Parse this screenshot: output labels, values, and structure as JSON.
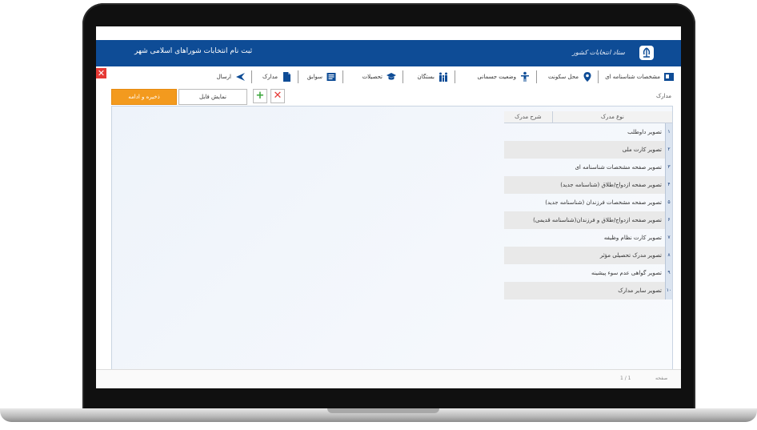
{
  "header": {
    "title": "ثبت نام انتخابات شوراهای اسلامی شهر",
    "brand": "ستاد انتخابات کشور",
    "brand_color": "#0e4c96"
  },
  "tabs": [
    {
      "label": "مشخصات شناسنامه ای",
      "icon": "id-card-icon"
    },
    {
      "label": "محل سکونت",
      "icon": "location-pin-icon"
    },
    {
      "label": "وضعیت جسمانی",
      "icon": "person-icon"
    },
    {
      "label": "بستگان",
      "icon": "family-icon"
    },
    {
      "label": "تحصیلات",
      "icon": "graduation-cap-icon"
    },
    {
      "label": "سوابق",
      "icon": "records-icon"
    },
    {
      "label": "مدارک",
      "icon": "documents-icon"
    },
    {
      "label": "ارسال",
      "icon": "send-icon"
    }
  ],
  "toolbar": {
    "section_label": "مدارک",
    "save_label": "ذخیره و ادامه",
    "show_file_label": "نمایش فایل",
    "add_icon": "plus-icon",
    "delete_icon": "x-icon"
  },
  "grid": {
    "col_type": "نوع مدرک",
    "col_desc": "شرح مدرک",
    "rows": [
      {
        "num": "۱",
        "label": "تصویر داوطلب"
      },
      {
        "num": "۲",
        "label": "تصویر کارت ملی"
      },
      {
        "num": "۳",
        "label": "تصویر صفحه مشخصات شناسنامه ای"
      },
      {
        "num": "۴",
        "label": "تصویر صفحه ازدواج/طلاق (شناسنامه جدید)"
      },
      {
        "num": "۵",
        "label": "تصویر صفحه مشخصات فرزندان (شناسنامه جدید)"
      },
      {
        "num": "۶",
        "label": "تصویر صفحه ازدواج/طلاق و فرزندان(شناسنامه قدیمی)"
      },
      {
        "num": "۷",
        "label": "تصویر کارت نظام وظیفه"
      },
      {
        "num": "۸",
        "label": "تصویر مدرک تحصیلی مؤثر"
      },
      {
        "num": "۹",
        "label": "تصویر گواهی عدم سوء پیشینه"
      },
      {
        "num": "۱۰",
        "label": "تصویر سایر مدارک"
      }
    ]
  },
  "footer": {
    "label": "صفحه",
    "page": "1 / 1"
  }
}
